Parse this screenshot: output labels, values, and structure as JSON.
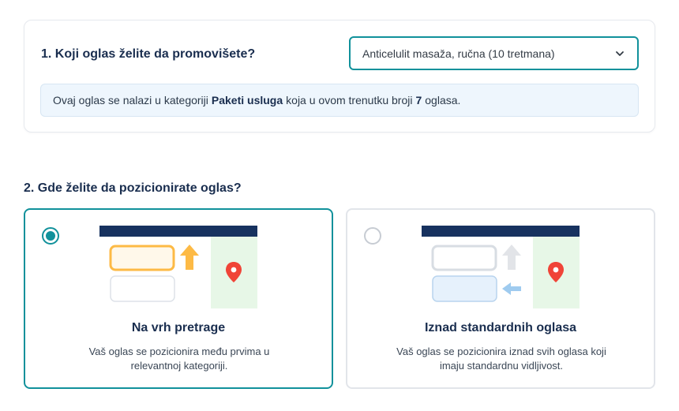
{
  "section1": {
    "question": "1. Koji oglas želite da promovišete?",
    "select_value": "Anticelulit masaža, ručna (10 tretmana)",
    "info": {
      "prefix": "Ovaj oglas se nalazi u kategoriji",
      "category": "Paketi usluga",
      "middle": "koja u ovom trenutku broji",
      "count": "7",
      "suffix": "oglasa."
    }
  },
  "section2": {
    "question": "2. Gde želite da pozicionirate oglas?",
    "options": [
      {
        "title": "Na vrh pretrage",
        "description": "Vaš oglas se pozicionira među prvima u relevantnoj kategoriji.",
        "selected": true
      },
      {
        "title": "Iznad standardnih oglasa",
        "description": "Vaš oglas se pozicionira iznad svih oglasa koji imaju standardnu vidljivost.",
        "selected": false
      }
    ]
  },
  "colors": {
    "accent": "#11919b",
    "navy": "#17325f",
    "info_bg": "#eef6fd",
    "map_green": "#e7f7e7",
    "pin_red": "#f04438",
    "arrow_orange": "#fdba45",
    "arrow_blue": "#9fcbef"
  }
}
